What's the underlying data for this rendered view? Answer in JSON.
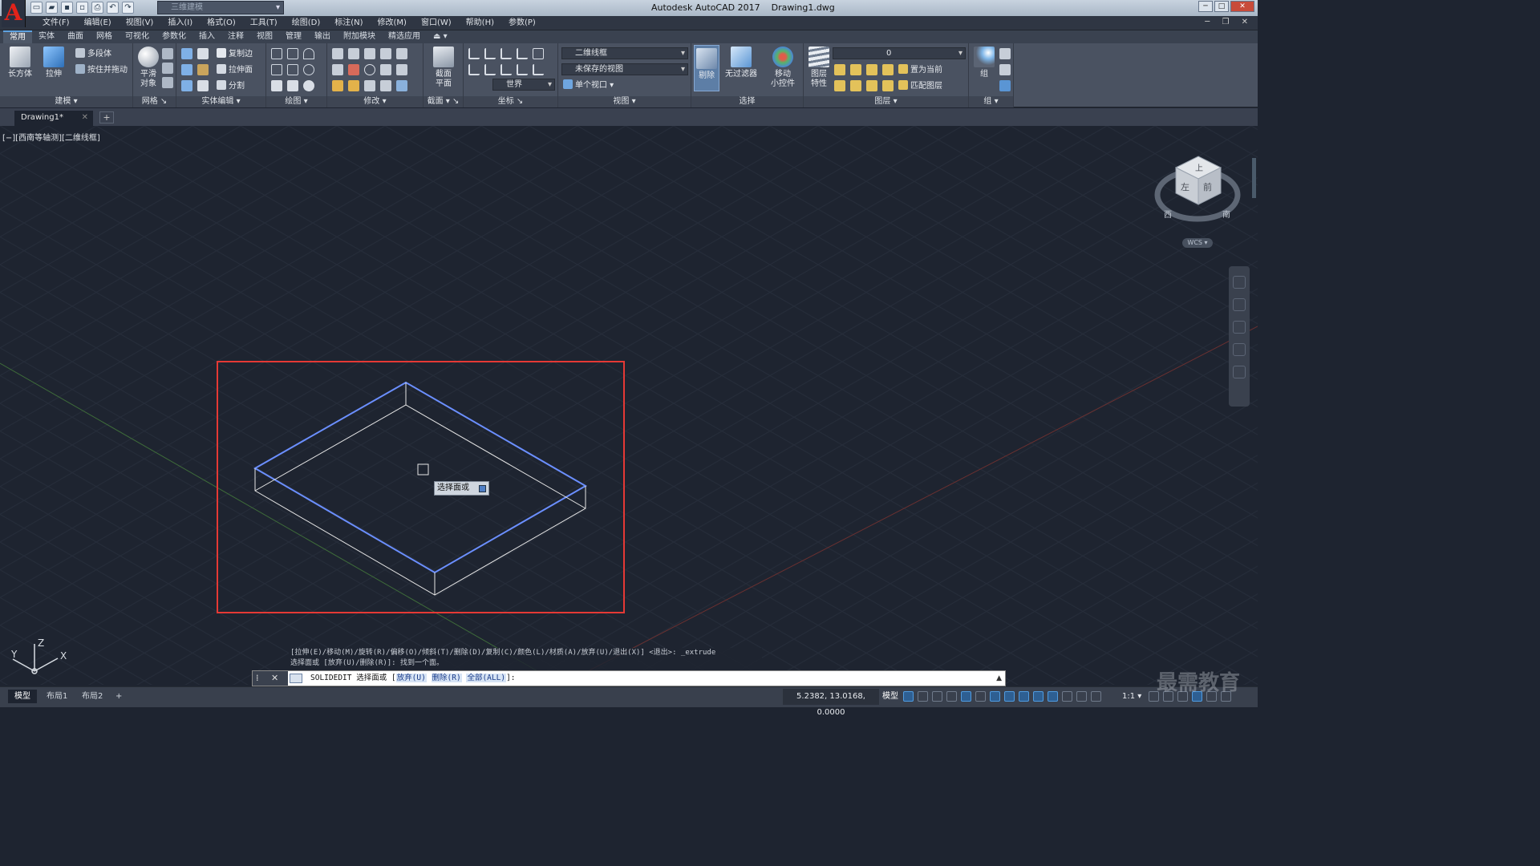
{
  "app": {
    "logo_letter": "A",
    "window_title": "Autodesk AutoCAD 2017",
    "document_name": "Drawing1.dwg",
    "workspace": "三维建模",
    "win_min": "─",
    "win_max": "□",
    "win_close": "✕",
    "doc_controls": "─ ❐ ✕",
    "quick_access": [
      {
        "name": "new-icon",
        "glyph": "▭"
      },
      {
        "name": "open-icon",
        "glyph": "▰"
      },
      {
        "name": "save-icon",
        "glyph": "▪"
      },
      {
        "name": "save-as-icon",
        "glyph": "▫"
      },
      {
        "name": "print-icon",
        "glyph": "⎙"
      },
      {
        "name": "undo-icon",
        "glyph": "↶"
      },
      {
        "name": "redo-icon",
        "glyph": "↷"
      }
    ]
  },
  "menu": [
    "文件(F)",
    "编辑(E)",
    "视图(V)",
    "插入(I)",
    "格式(O)",
    "工具(T)",
    "绘图(D)",
    "标注(N)",
    "修改(M)",
    "窗口(W)",
    "帮助(H)",
    "参数(P)"
  ],
  "ribbon_tabs": [
    "常用",
    "实体",
    "曲面",
    "网格",
    "可视化",
    "参数化",
    "插入",
    "注释",
    "视图",
    "管理",
    "输出",
    "附加模块",
    "精选应用",
    "⏏ ▾"
  ],
  "ribbon": {
    "modeling": {
      "label": "建模 ▾",
      "box": "长方体",
      "extrude": "拉伸",
      "polysolid": "多段体",
      "presspull": "按住并拖动"
    },
    "mesh": {
      "label": "网格 ↘",
      "smooth": "平滑",
      "smooth2": "对象"
    },
    "solid_edit": {
      "label": "实体编辑 ▾",
      "copy_edge": "复制边",
      "extrude_face": "拉伸面",
      "separate": "分割"
    },
    "draw": {
      "label": "绘图 ▾"
    },
    "modify": {
      "label": "修改 ▾"
    },
    "section": {
      "label": "截面 ▾ ↘",
      "plane": "截面",
      "plane2": "平面"
    },
    "coordinates": {
      "label": "坐标 ↘",
      "world": "世界"
    },
    "view": {
      "label": "视图 ▾",
      "visual_style": "二维线框",
      "saved_view": "未保存的视图",
      "viewport": "单个视口 ▾"
    },
    "selection": {
      "label": "选择",
      "cull": "剔除",
      "no_filter": "无过滤器"
    },
    "gizmo": {
      "move": "移动",
      "move2": "小控件"
    },
    "layers": {
      "label": "图层 ▾",
      "properties": "图层",
      "properties2": "特性",
      "layer_value": "0",
      "set_current": "置为当前",
      "match": "匹配图层"
    },
    "groups": {
      "label": "组 ▾",
      "group": "组"
    }
  },
  "doc_tab": {
    "name": "Drawing1*",
    "close": "✕",
    "new": "+"
  },
  "viewport": {
    "label": "[−][西南等轴测][二维线框]",
    "tooltip": "选择面或",
    "viewcube": {
      "top": "上",
      "left": "左",
      "front": "前",
      "west": "西",
      "south": "南"
    },
    "wcs": "WCS ▾",
    "ucs": {
      "x": "X",
      "y": "Y",
      "z": "Z"
    },
    "colors": {
      "background": "#1e2430",
      "highlight": "#6b8fff",
      "edges": "#e6e6e6",
      "selection_box": "#e53935",
      "grid": "#2a3140"
    }
  },
  "command": {
    "history_1": "[拉伸(E)/移动(M)/旋转(R)/偏移(O)/倾斜(T)/删除(D)/复制(C)/颜色(L)/材质(A)/放弃(U)/退出(X)] <退出>: _extrude",
    "history_2": "选择面或 [放弃(U)/删除(R)]: 找到一个面。",
    "grip": "⁞ ✕ 🔧",
    "prompt_cmd": "SOLIDEDIT 选择面或 [",
    "opt_undo": "放弃(U)",
    "opt_remove": "删除(R)",
    "opt_all": "全部(ALL)",
    "prompt_end": "]:",
    "scroll": "▲"
  },
  "statusbar": {
    "tabs": [
      "模型",
      "布局1",
      "布局2",
      "+"
    ],
    "coords": "5.2382, 13.0168, 0.0000",
    "model": "模型",
    "scale": "1:1 ▾"
  },
  "watermark": "最需教育"
}
